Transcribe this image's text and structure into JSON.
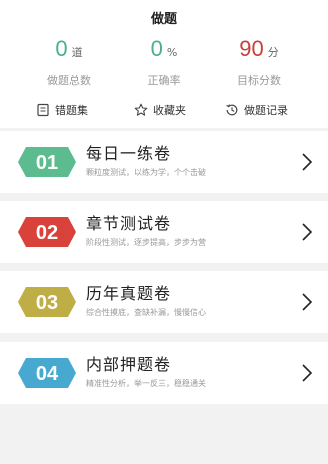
{
  "header": {
    "title": "做题"
  },
  "stats": [
    {
      "value": "0",
      "unit": "道",
      "label": "做题总数",
      "color": "#4caf8c"
    },
    {
      "value": "0",
      "unit": "%",
      "label": "正确率",
      "color": "#4caf8c"
    },
    {
      "value": "90",
      "unit": "分",
      "label": "目标分数",
      "color": "#c9403a"
    }
  ],
  "quick_links": [
    {
      "label": "错题集",
      "icon": "notebook-icon"
    },
    {
      "label": "收藏夹",
      "icon": "star-icon"
    },
    {
      "label": "做题记录",
      "icon": "history-icon"
    }
  ],
  "papers": [
    {
      "number": "01",
      "title": "每日一练卷",
      "desc": "颗粒度测试，以练为学，个个击破",
      "color": "#5dbb90",
      "icon": "chevron-right-icon"
    },
    {
      "number": "02",
      "title": "章节测试卷",
      "desc": "阶段性测试，逐步提高，步步为营",
      "color": "#d9413b",
      "icon": "chevron-right-icon"
    },
    {
      "number": "03",
      "title": "历年真题卷",
      "desc": "综合性摸底，查缺补漏，慢慢信心",
      "color": "#bfae46",
      "icon": "chevron-right-icon"
    },
    {
      "number": "04",
      "title": "内部押题卷",
      "desc": "精准性分析，举一反三，稳稳通关",
      "color": "#47a9cf",
      "icon": "chevron-right-icon"
    }
  ]
}
